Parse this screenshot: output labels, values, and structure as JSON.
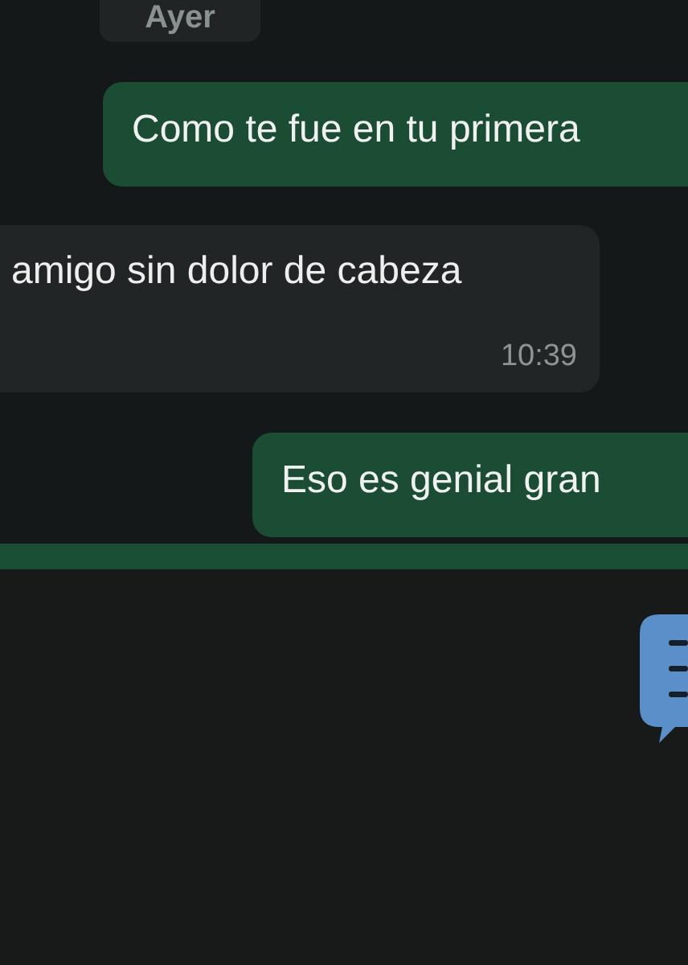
{
  "date_chip": "Ayer",
  "messages": [
    {
      "kind": "outgoing",
      "text": "Como te fue en tu primera"
    },
    {
      "kind": "incoming",
      "text": "amigo sin dolor de cabeza",
      "time": "10:39"
    },
    {
      "kind": "outgoing",
      "text": "Eso es genial gran"
    }
  ]
}
